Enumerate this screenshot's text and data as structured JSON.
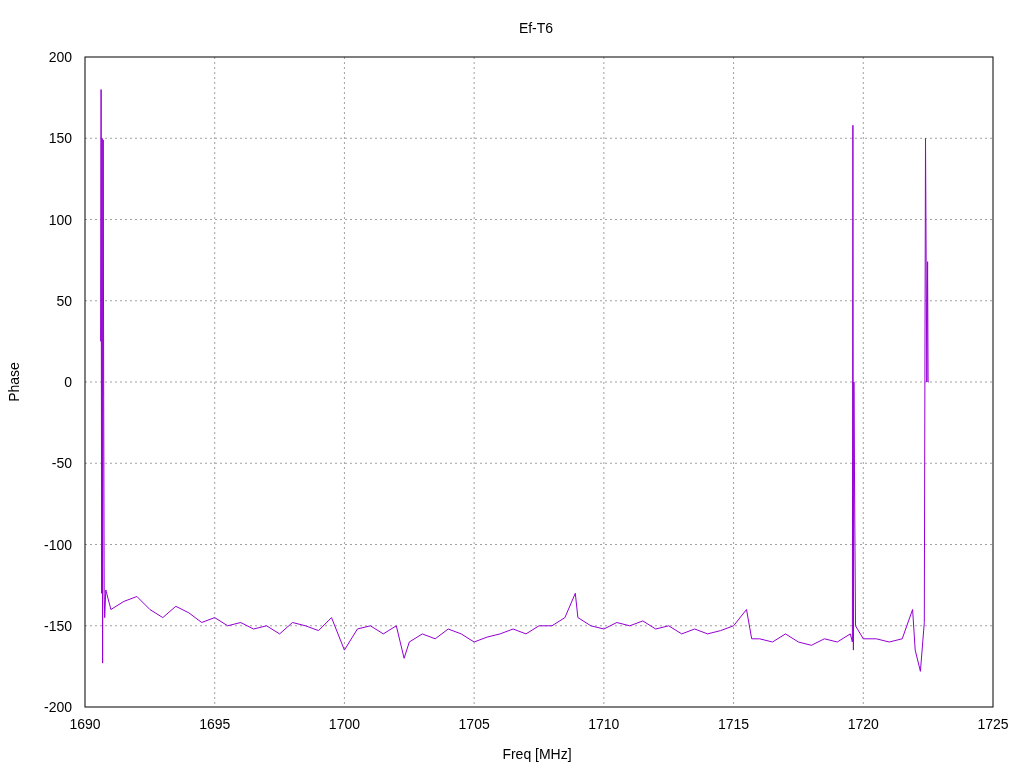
{
  "chart_data": {
    "type": "line",
    "title": "Ef-T6",
    "xlabel": "Freq [MHz]",
    "ylabel": "Phase",
    "grid": true,
    "xlim": [
      1690,
      1725
    ],
    "ylim": [
      -200,
      200
    ],
    "xticks": [
      1690,
      1695,
      1700,
      1705,
      1710,
      1715,
      1720,
      1725
    ],
    "yticks": [
      -200,
      -150,
      -100,
      -50,
      0,
      50,
      100,
      150,
      200
    ],
    "x": [
      1690.6,
      1690.62,
      1690.64,
      1690.66,
      1690.68,
      1690.7,
      1690.72,
      1690.74,
      1690.76,
      1690.8,
      1691,
      1691.5,
      1692,
      1692.5,
      1693,
      1693.5,
      1694,
      1694.5,
      1695,
      1695.5,
      1696,
      1696.5,
      1697,
      1697.5,
      1698,
      1698.5,
      1699,
      1699.5,
      1700,
      1700.5,
      1701,
      1701.5,
      1702,
      1702.3,
      1702.5,
      1703,
      1703.5,
      1704,
      1704.5,
      1705,
      1705.5,
      1706,
      1706.5,
      1707,
      1707.5,
      1708,
      1708.5,
      1708.9,
      1709,
      1709.5,
      1710,
      1710.5,
      1711,
      1711.5,
      1712,
      1712.5,
      1713,
      1713.5,
      1714,
      1714.5,
      1715,
      1715.5,
      1715.7,
      1716,
      1716.5,
      1717,
      1717.5,
      1718,
      1718.5,
      1719,
      1719.5,
      1719.58,
      1719.6,
      1719.62,
      1719.64,
      1719.7,
      1720,
      1720.5,
      1721,
      1721.5,
      1721.9,
      1722,
      1722.2,
      1722.35,
      1722.4,
      1722.45,
      1722.48,
      1722.5,
      1722.52
    ],
    "series": [
      {
        "color": "#9400d3",
        "values": [
          25,
          180,
          -130,
          150,
          -173,
          149,
          -10,
          -130,
          -145,
          -128,
          -140,
          -135,
          -132,
          -140,
          -145,
          -138,
          -142,
          -148,
          -145,
          -150,
          -148,
          -152,
          -150,
          -155,
          -148,
          -150,
          -153,
          -145,
          -165,
          -152,
          -150,
          -155,
          -150,
          -170,
          -160,
          -155,
          -158,
          -152,
          -155,
          -160,
          -157,
          -155,
          -152,
          -155,
          -150,
          -150,
          -145,
          -130,
          -145,
          -150,
          -152,
          -148,
          -150,
          -147,
          -152,
          -150,
          -155,
          -152,
          -155,
          -153,
          -150,
          -140,
          -158,
          -158,
          -160,
          -155,
          -160,
          -162,
          -158,
          -160,
          -155,
          -160,
          158,
          -165,
          0,
          -150,
          -158,
          -158,
          -160,
          -158,
          -140,
          -165,
          -178,
          -148,
          150,
          0,
          74,
          0,
          0
        ]
      }
    ]
  }
}
